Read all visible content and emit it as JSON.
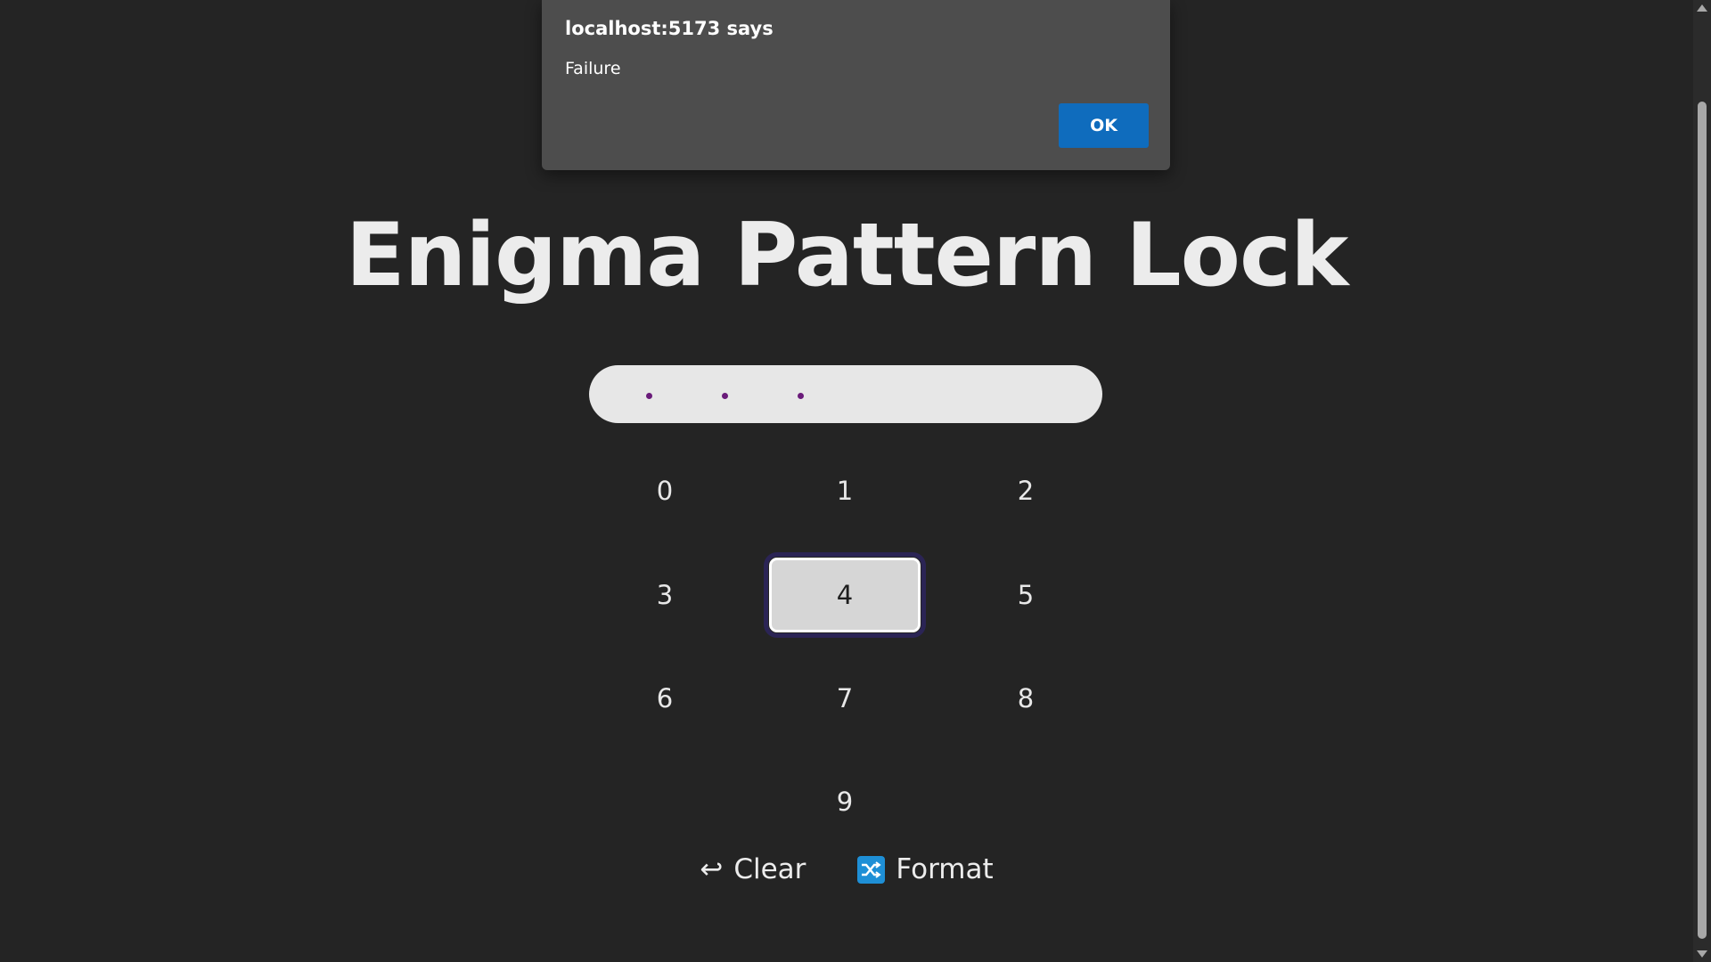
{
  "dialog": {
    "title": "localhost:5173 says",
    "message": "Failure",
    "ok_label": "OK"
  },
  "page": {
    "title": "Enigma Pattern Lock"
  },
  "display": {
    "entered_count": 3,
    "dot_color": "#6a1b7a"
  },
  "keypad": {
    "keys": [
      "0",
      "1",
      "2",
      "3",
      "4",
      "5",
      "6",
      "7",
      "8",
      "9"
    ],
    "focused_key": "4"
  },
  "actions": {
    "clear_icon": "↩",
    "clear_label": "Clear",
    "format_icon": "shuffle-icon",
    "format_label": "Format",
    "format_icon_color": "#1e8fd6"
  }
}
